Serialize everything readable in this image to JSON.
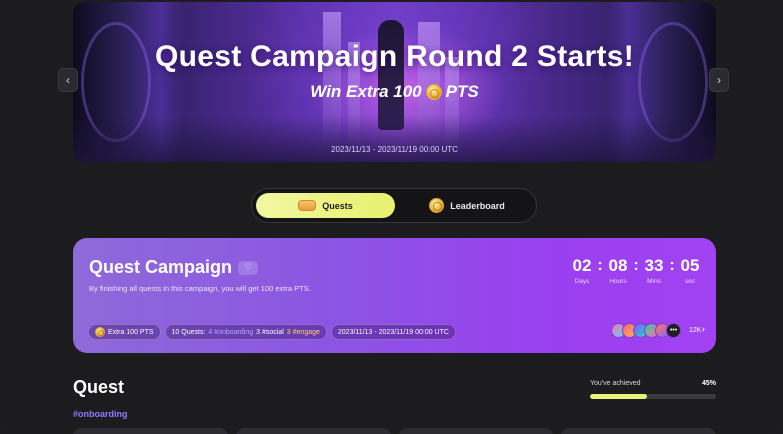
{
  "banner": {
    "title": "Quest Campaign Round 2 Starts!",
    "subtitle_prefix": "Win Extra 100",
    "subtitle_suffix": "PTS",
    "date": "2023/11/13 - 2023/11/19 00:00 UTC",
    "prev_icon": "chevron-left-icon",
    "next_icon": "chevron-right-icon"
  },
  "toggle": {
    "quests_label": "Quests",
    "leaderboard_label": "Leaderboard",
    "active": "Quests"
  },
  "campaign": {
    "title": "Quest Campaign",
    "description": "By finishing all quests in this campaign, you will get 100 extra PTS.",
    "countdown": {
      "days": "02",
      "hours": "08",
      "mins": "33",
      "sec": "05",
      "days_label": "Days",
      "hours_label": "Hours",
      "mins_label": "Mins",
      "sec_label": "sec"
    },
    "tags": {
      "reward": "Extra 100 PTS",
      "quests_count": "10 Quests:",
      "onboarding": "4 #onboarding",
      "social": "3 #social",
      "engage": "3 #engage",
      "date_range": "2023/11/13 - 2023/11/19 00:00 UTC"
    },
    "participants_count": "12K+",
    "more_icon": "ellipsis-icon"
  },
  "quest_section": {
    "heading": "Quest",
    "first_tag": "#onboarding",
    "achieved_label": "You've achieved",
    "achieved_pct": "45%",
    "achieved_value": 0.45
  },
  "colors": {
    "accent_yellow": "#e9f27a",
    "card_purple": "#9a3ff0",
    "tag_onboarding": "#8d7bff",
    "tag_engage": "#ffd36b"
  }
}
